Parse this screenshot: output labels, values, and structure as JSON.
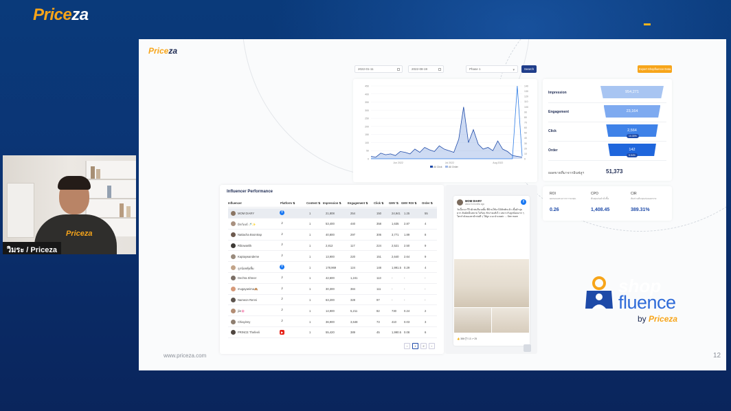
{
  "brand": {
    "top_left": "Price",
    "top_left_accent": "za"
  },
  "webcam": {
    "caption": "วิมระ / Priceza",
    "shirt_text": "Priceza"
  },
  "slide": {
    "brand": "Price",
    "brand_accent": "za",
    "footer_url": "www.priceza.com",
    "page_number": "12",
    "filters": {
      "start_date": "2022-01-11",
      "end_date": "2022-08-19",
      "select": "Phase 1",
      "search_label": "Search",
      "export_label": "Export Shopfluence Data"
    },
    "chart_data": {
      "type": "line",
      "x_tick_labels": [
        "Jun 2022",
        "Jul 2022",
        "Aug 2022"
      ],
      "y_left_ticks": [
        0,
        50,
        100,
        150,
        200,
        250,
        300,
        350,
        400,
        450
      ],
      "y_right_ticks": [
        0,
        10,
        20,
        30,
        40,
        50,
        60,
        70,
        80,
        90,
        100,
        110,
        120,
        130,
        140
      ],
      "legend": [
        "All Click",
        "All Order"
      ],
      "series": [
        {
          "name": "All Click",
          "values": [
            15,
            10,
            35,
            25,
            30,
            20,
            45,
            40,
            30,
            60,
            40,
            70,
            55,
            45,
            80,
            60,
            50,
            40,
            120,
            320,
            100,
            180,
            90,
            60,
            70,
            50,
            110,
            60,
            45,
            20,
            15,
            10
          ]
        },
        {
          "name": "All Order",
          "values": [
            0,
            0,
            0,
            0,
            0,
            0,
            0,
            0,
            0,
            0,
            0,
            0,
            0,
            0,
            0,
            0,
            0,
            0,
            0,
            0,
            0,
            0,
            0,
            0,
            0,
            0,
            0,
            0,
            0,
            0,
            140,
            5
          ]
        }
      ]
    },
    "funnel": [
      {
        "label": "Impression",
        "value": "954,271",
        "value_fraction": 1.0
      },
      {
        "label": "Engagement",
        "value": "23,164",
        "value_fraction": 0.9
      },
      {
        "label": "Click",
        "value": "2,564",
        "badge": "10.30%",
        "value_fraction": 0.82
      },
      {
        "label": "Order",
        "value": "142",
        "badge": "5.54%",
        "value_fraction": 0.76
      }
    ],
    "total": {
      "label": "ยอดขายที่มาจากอินฟลูฯ",
      "value": "51,373"
    },
    "kpis": [
      {
        "key": "ROI",
        "sub": "ผลตอบแทนจากการลงทุน",
        "value": "0.26"
      },
      {
        "key": "CPO",
        "sub": "ต้นทุนต่อคำสั่งซื้อ",
        "value": "1,408.45"
      },
      {
        "key": "CIR",
        "sub": "สัดส่วนต้นทุนต่อยอดขาย",
        "value": "389.31%"
      }
    ],
    "table": {
      "title": "Influencer Performance",
      "headers": [
        "Influencer",
        "Platform",
        "Content",
        "Impression",
        "Engagement",
        "Click",
        "GMV",
        "GMV ROI",
        "Order"
      ],
      "rows": [
        {
          "name": "MOM DIARY",
          "platform": "facebook",
          "content": "1",
          "impression": "21,808",
          "engagement": "254",
          "click": "150",
          "gmv": "24,941",
          "roi": "1.25",
          "order": "55",
          "avatar": "#8a7563"
        },
        {
          "name": "มิกก์เบบ้ 🍼✨",
          "platform": "tiktok",
          "content": "1",
          "impression": "53,400",
          "engagement": "440",
          "click": "358",
          "gmv": "1,635",
          "roi": "2.87",
          "order": "4",
          "avatar": "#a89180"
        },
        {
          "name": "Nattacha Boontrap",
          "platform": "tiktok",
          "content": "1",
          "impression": "40,800",
          "engagement": "297",
          "click": "306",
          "gmv": "3,771",
          "roi": "1.89",
          "order": "8",
          "avatar": "#6d5a4e"
        },
        {
          "name": "Ribowanlik",
          "platform": "tiktok",
          "content": "1",
          "impression": "2,812",
          "engagement": "117",
          "click": "224",
          "gmv": "2,521",
          "roi": "2.50",
          "order": "9",
          "avatar": "#3e3a36"
        },
        {
          "name": "Kaptaywandeme",
          "platform": "tiktok",
          "content": "1",
          "impression": "13,900",
          "engagement": "220",
          "click": "151",
          "gmv": "2,640",
          "roi": "2.64",
          "order": "9",
          "avatar": "#9a8b7d"
        },
        {
          "name": "ลูกน้อยหุ้มยิ้ม",
          "platform": "facebook",
          "content": "1",
          "impression": "178,969",
          "engagement": "124",
          "click": "148",
          "gmv": "1,991.5",
          "roi": "0.29",
          "order": "4",
          "avatar": "#c2a489"
        },
        {
          "name": "Dechra Shreer",
          "platform": "tiktok",
          "content": "1",
          "impression": "42,600",
          "engagement": "1,241",
          "click": "113",
          "gmv": "-",
          "roi": "-",
          "order": "-",
          "avatar": "#7b6f66"
        },
        {
          "name": "mugayanima🙈",
          "platform": "tiktok",
          "content": "1",
          "impression": "30,300",
          "engagement": "384",
          "click": "111",
          "gmv": "-",
          "roi": "-",
          "order": "-",
          "avatar": "#d69a7a"
        },
        {
          "name": "Nameon Renni",
          "platform": "tiktok",
          "content": "1",
          "impression": "63,200",
          "engagement": "328",
          "click": "97",
          "gmv": "-",
          "roi": "-",
          "order": "-",
          "avatar": "#5d544e"
        },
        {
          "name": "jiin🌸",
          "platform": "tiktok",
          "content": "1",
          "impression": "14,900",
          "engagement": "5,211",
          "click": "82",
          "gmv": "730",
          "roi": "0.24",
          "order": "2",
          "avatar": "#b38d74"
        },
        {
          "name": "Chiayinny",
          "platform": "tiktok",
          "content": "1",
          "impression": "36,900",
          "engagement": "3,648",
          "click": "73",
          "gmv": "410",
          "roi": "0.03",
          "order": "3",
          "avatar": "#8e7e70"
        },
        {
          "name": "PRINCE Thefeeli",
          "platform": "youtube",
          "content": "1",
          "impression": "55,420",
          "engagement": "389",
          "click": "45",
          "gmv": "1,990.5",
          "roi": "0.08",
          "order": "6",
          "avatar": "#4f4640"
        }
      ],
      "pages": [
        "1",
        "2"
      ]
    },
    "post": {
      "author": "MOM DIARY",
      "time": "about 6 months ago",
      "text": "วันนี้จะมาวีวิวผ้าห่มสีนวลยิ้ม ที่บ้านใช้มาได้สักพักแล้ว เนื้อผ้านุ่มมาก สัมผัสเย็นสบาย ไม่ร้อน ซักง่ายแห้งไว เหมาะกับลูกน้อยมาก ๆ ใครกำลังมองหาผ้าห่มดี ๆ ให้ลูก แนะนำเลยค่ะ ... See more",
      "stats": "👍 386   💬 13   ↗ 25"
    }
  },
  "shopfluence": {
    "shop": "shop",
    "fluence": "fluence",
    "by": "by",
    "priceza": "Priceza"
  }
}
